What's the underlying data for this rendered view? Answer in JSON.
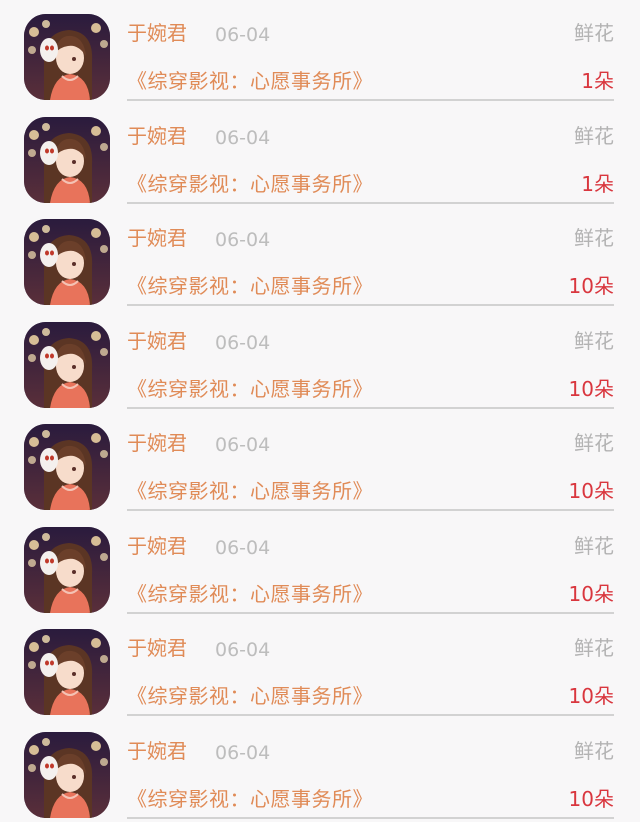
{
  "colors": {
    "accent_orange": "#e08b57",
    "count_red": "#d9363e",
    "muted_gray": "#b3b3b3",
    "date_gray": "#bdbdbd",
    "background": "#f8f7f8"
  },
  "rows": [
    {
      "avatar_icon": "user-avatar-anime-girl",
      "username": "于婉君",
      "date": "06-04",
      "gift": "鲜花",
      "book": "《综穿影视：心愿事务所》",
      "count": "1朵"
    },
    {
      "avatar_icon": "user-avatar-anime-girl",
      "username": "于婉君",
      "date": "06-04",
      "gift": "鲜花",
      "book": "《综穿影视：心愿事务所》",
      "count": "1朵"
    },
    {
      "avatar_icon": "user-avatar-anime-girl",
      "username": "于婉君",
      "date": "06-04",
      "gift": "鲜花",
      "book": "《综穿影视：心愿事务所》",
      "count": "10朵"
    },
    {
      "avatar_icon": "user-avatar-anime-girl",
      "username": "于婉君",
      "date": "06-04",
      "gift": "鲜花",
      "book": "《综穿影视：心愿事务所》",
      "count": "10朵"
    },
    {
      "avatar_icon": "user-avatar-anime-girl",
      "username": "于婉君",
      "date": "06-04",
      "gift": "鲜花",
      "book": "《综穿影视：心愿事务所》",
      "count": "10朵"
    },
    {
      "avatar_icon": "user-avatar-anime-girl",
      "username": "于婉君",
      "date": "06-04",
      "gift": "鲜花",
      "book": "《综穿影视：心愿事务所》",
      "count": "10朵"
    },
    {
      "avatar_icon": "user-avatar-anime-girl",
      "username": "于婉君",
      "date": "06-04",
      "gift": "鲜花",
      "book": "《综穿影视：心愿事务所》",
      "count": "10朵"
    },
    {
      "avatar_icon": "user-avatar-anime-girl",
      "username": "于婉君",
      "date": "06-04",
      "gift": "鲜花",
      "book": "《综穿影视：心愿事务所》",
      "count": "10朵"
    }
  ]
}
